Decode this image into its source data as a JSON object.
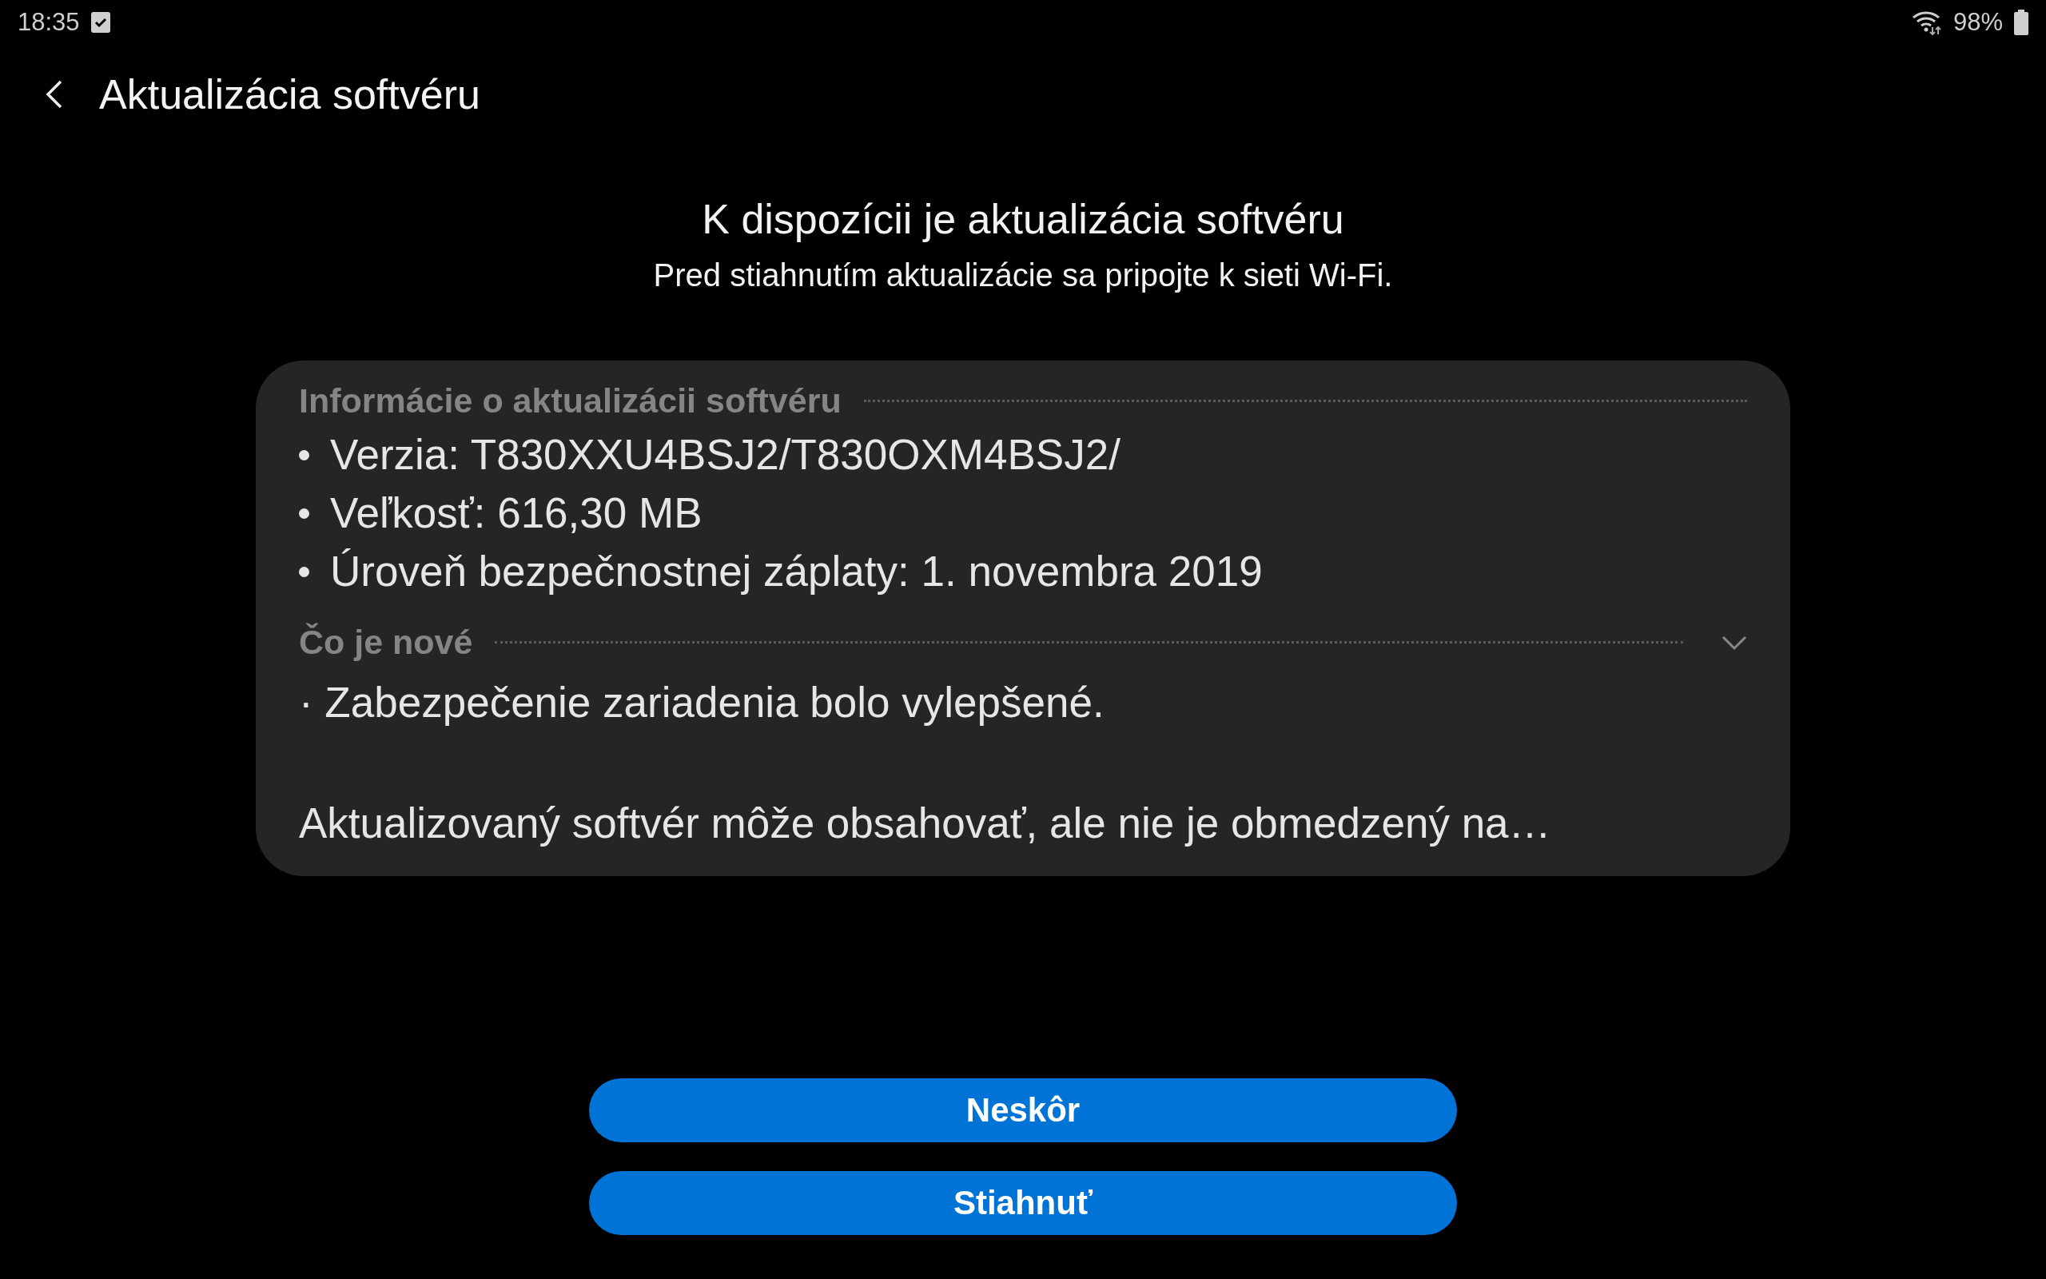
{
  "status_bar": {
    "time": "18:35",
    "battery": "98%"
  },
  "header": {
    "title": "Aktualizácia softvéru"
  },
  "heading": "K dispozícii je aktualizácia softvéru",
  "subtitle": "Pred stiahnutím aktualizácie sa pripojte k sieti Wi-Fi.",
  "info": {
    "title": "Informácie o aktualizácii softvéru",
    "items": [
      "Verzia: T830XXU4BSJ2/T830OXM4BSJ2/",
      "Veľkosť: 616,30 MB",
      "Úroveň bezpečnostnej záplaty: 1. novembra 2019"
    ]
  },
  "whats_new": {
    "title": "Čo je nové",
    "expanded": false,
    "lines": [
      "· Zabezpečenie zariadenia bolo vylepšené.",
      "Aktualizovaný softvér môže obsahovať, ale nie je obmedzený na…"
    ]
  },
  "buttons": [
    "Neskôr",
    "Stiahnuť"
  ]
}
